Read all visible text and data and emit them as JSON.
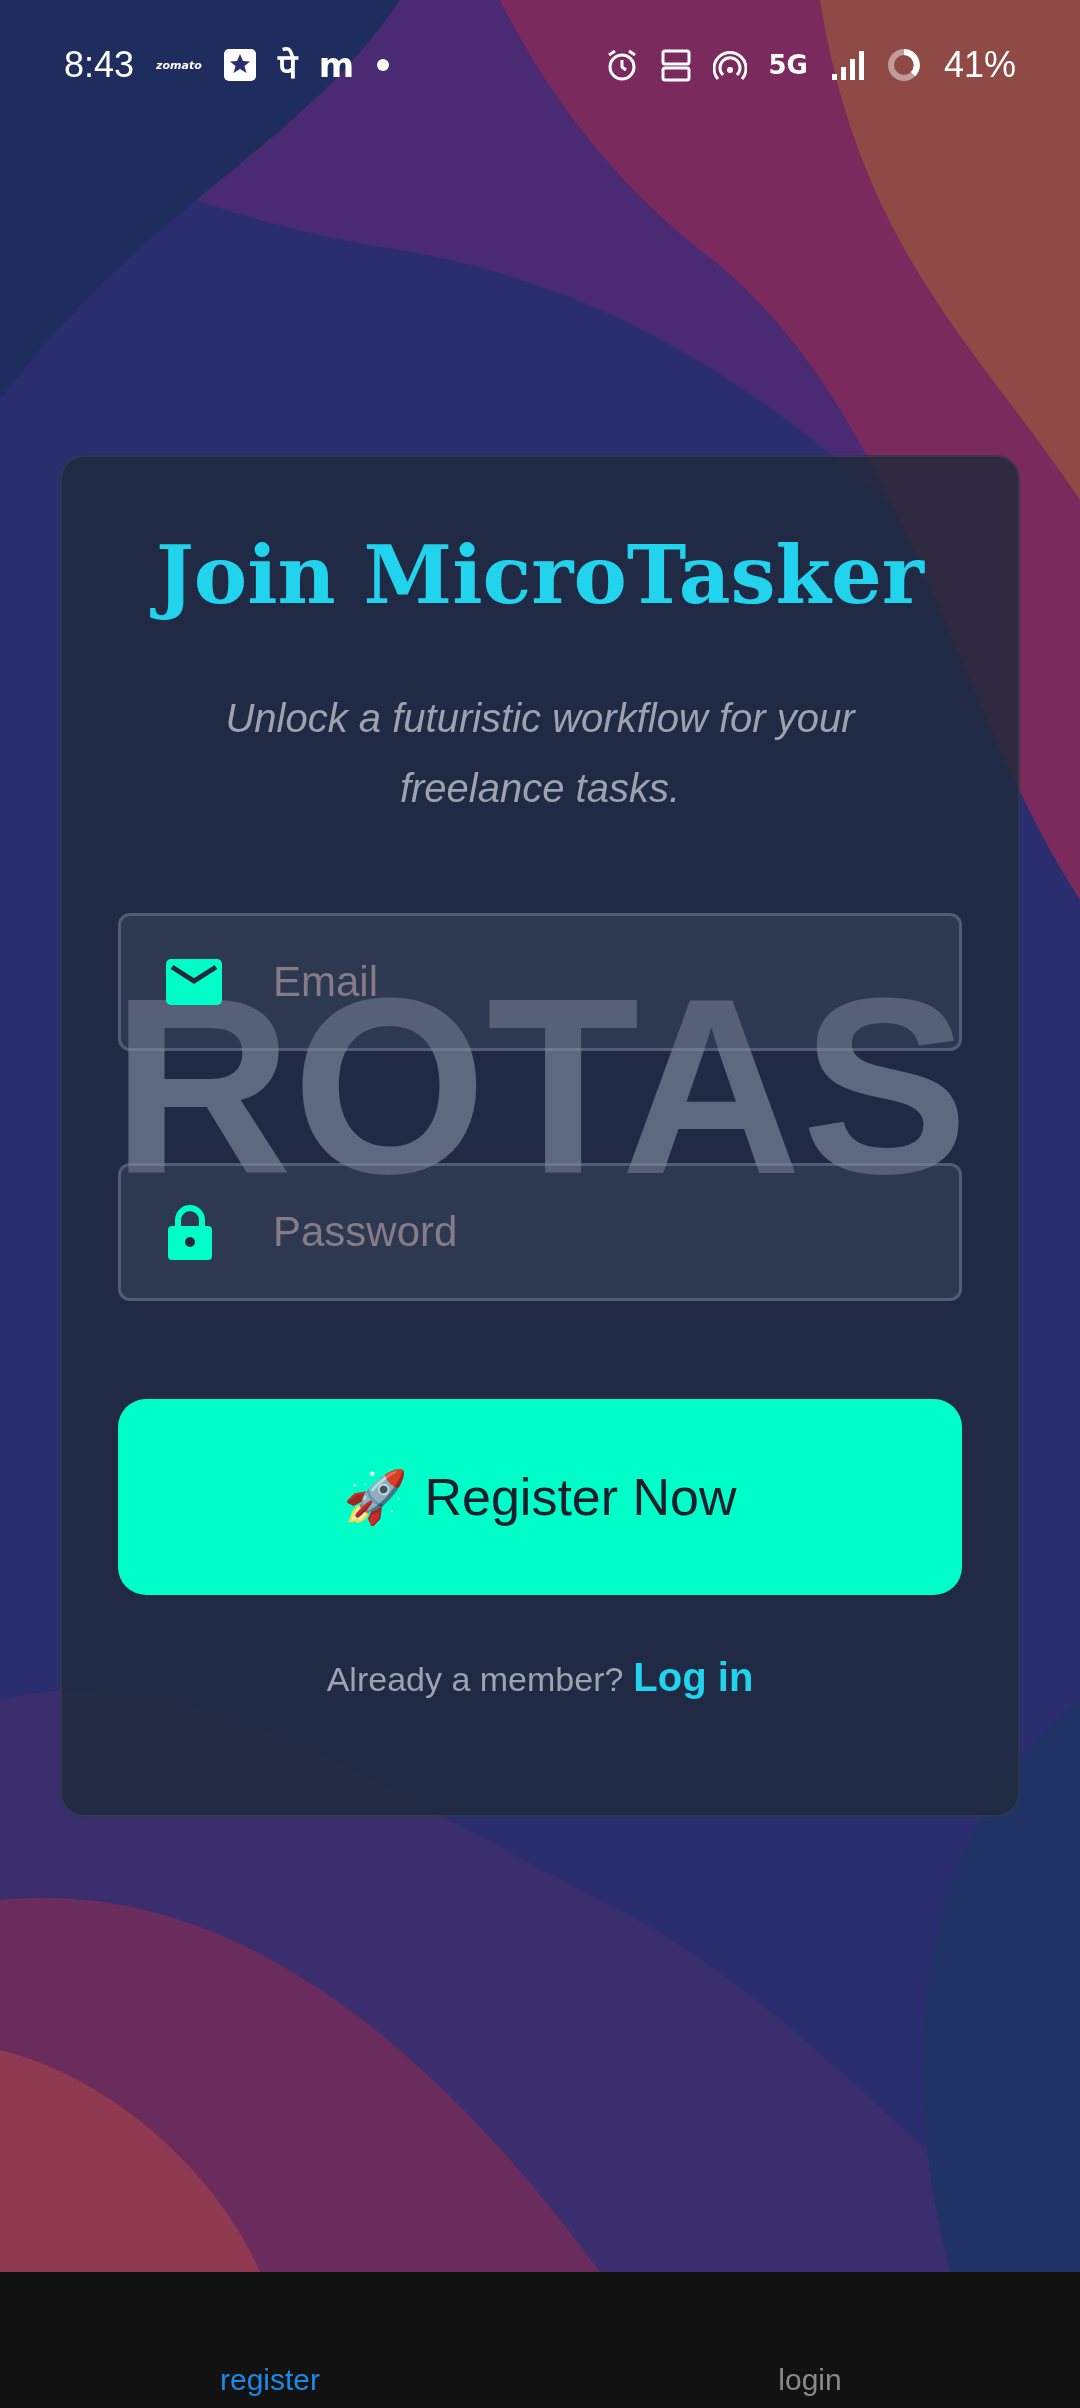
{
  "status_bar": {
    "time": "8:43",
    "app_labels": [
      "zomato",
      "पे",
      "m"
    ],
    "network": "5G",
    "battery": "41%"
  },
  "backdrop_text": "ROTAS",
  "card": {
    "title": "Join MicroTasker",
    "subtitle": "Unlock a futuristic workflow for your freelance tasks.",
    "fields": [
      {
        "kind": "email",
        "placeholder": "Email"
      },
      {
        "kind": "password",
        "placeholder": "Password"
      }
    ],
    "button": {
      "icon": "🚀",
      "label": "Register Now"
    },
    "footer": {
      "prompt": "Already a member?",
      "link": "Log in"
    }
  },
  "bottom_tabs": [
    {
      "label": "register",
      "selected": true
    },
    {
      "label": "login",
      "selected": false
    }
  ]
}
